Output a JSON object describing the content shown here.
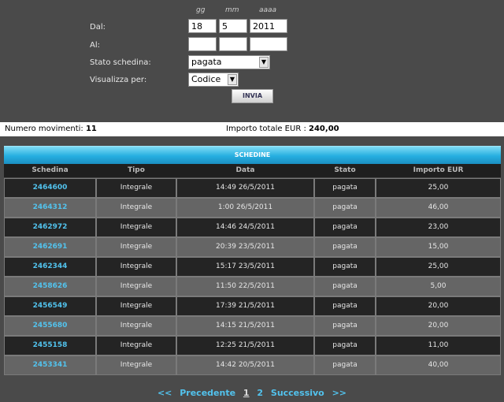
{
  "form": {
    "headers": {
      "gg": "gg",
      "mm": "mm",
      "aaaa": "aaaa"
    },
    "dal_label": "Dal:",
    "al_label": "Al:",
    "stato_label": "Stato schedina:",
    "visualizza_label": "Visualizza per:",
    "dal": {
      "gg": "18",
      "mm": "5",
      "aaaa": "2011"
    },
    "al": {
      "gg": "",
      "mm": "",
      "aaaa": ""
    },
    "stato_value": "pagata",
    "visualizza_value": "Codice",
    "submit_label": "INVIA"
  },
  "summary": {
    "movimenti_label": "Numero movimenti:",
    "movimenti_value": "11",
    "importo_label": "Importo totale EUR :",
    "importo_value": "240,00"
  },
  "table": {
    "title": "SCHEDINE",
    "columns": [
      "Schedina",
      "Tipo",
      "Data",
      "Stato",
      "Importo EUR"
    ],
    "rows": [
      [
        "2464600",
        "Integrale",
        "14:49 26/5/2011",
        "pagata",
        "25,00"
      ],
      [
        "2464312",
        "Integrale",
        "1:00 26/5/2011",
        "pagata",
        "46,00"
      ],
      [
        "2462972",
        "Integrale",
        "14:46 24/5/2011",
        "pagata",
        "23,00"
      ],
      [
        "2462691",
        "Integrale",
        "20:39 23/5/2011",
        "pagata",
        "15,00"
      ],
      [
        "2462344",
        "Integrale",
        "15:17 23/5/2011",
        "pagata",
        "25,00"
      ],
      [
        "2458626",
        "Integrale",
        "11:50 22/5/2011",
        "pagata",
        "5,00"
      ],
      [
        "2456549",
        "Integrale",
        "17:39 21/5/2011",
        "pagata",
        "20,00"
      ],
      [
        "2455680",
        "Integrale",
        "14:15 21/5/2011",
        "pagata",
        "20,00"
      ],
      [
        "2455158",
        "Integrale",
        "12:25 21/5/2011",
        "pagata",
        "11,00"
      ],
      [
        "2453341",
        "Integrale",
        "14:42 20/5/2011",
        "pagata",
        "40,00"
      ]
    ]
  },
  "pager": {
    "first": "<<",
    "prev": "Precedente",
    "pages": [
      "1",
      "2"
    ],
    "next": "Successivo",
    "last": ">>"
  },
  "colors": {
    "link": "#52c3ee",
    "band": "#25aee0"
  }
}
